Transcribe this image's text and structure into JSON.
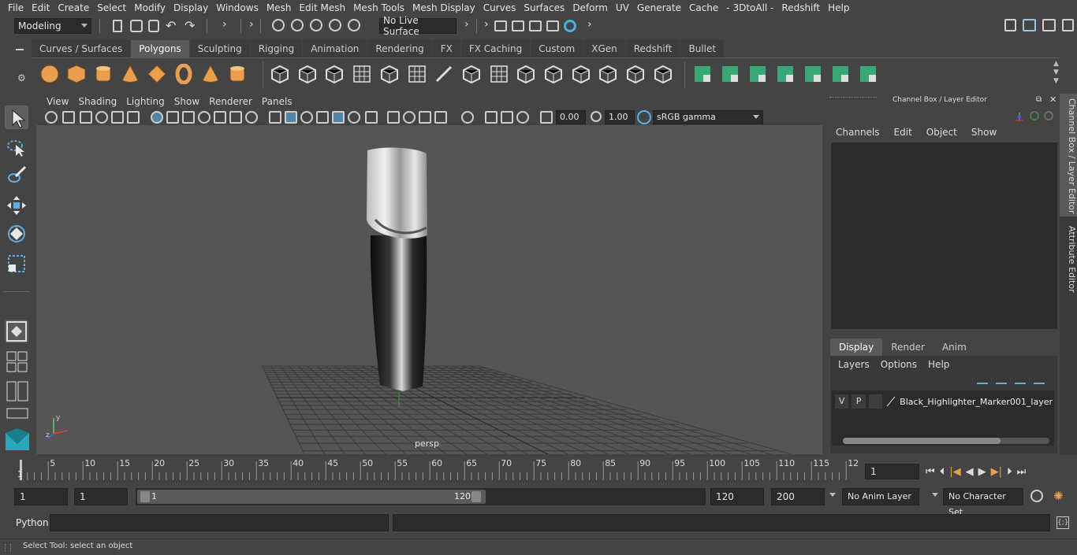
{
  "menubar": {
    "items": [
      "File",
      "Edit",
      "Create",
      "Select",
      "Modify",
      "Display",
      "Windows",
      "Mesh",
      "Edit Mesh",
      "Mesh Tools",
      "Mesh Display",
      "Curves",
      "Surfaces",
      "Deform",
      "UV",
      "Generate",
      "Cache",
      "- 3DtoAll -",
      "Redshift",
      "Help"
    ]
  },
  "statusline": {
    "mode": "Modeling",
    "live_surface": "No Live Surface"
  },
  "shelf": {
    "tabs": [
      "Curves / Surfaces",
      "Polygons",
      "Sculpting",
      "Rigging",
      "Animation",
      "Rendering",
      "FX",
      "FX Caching",
      "Custom",
      "XGen",
      "Redshift",
      "Bullet"
    ],
    "active_tab": "Polygons"
  },
  "viewport": {
    "menus": [
      "View",
      "Shading",
      "Lighting",
      "Show",
      "Renderer",
      "Panels"
    ],
    "exposure": "0.00",
    "gamma": "1.00",
    "color_space": "sRGB gamma",
    "camera_label": "persp"
  },
  "channel_box": {
    "title": "Channel Box / Layer Editor",
    "menus": [
      "Channels",
      "Edit",
      "Object",
      "Show"
    ],
    "layer_tabs": [
      "Display",
      "Render",
      "Anim"
    ],
    "active_layer_tab": "Display",
    "layer_menus": [
      "Layers",
      "Options",
      "Help"
    ],
    "layer": {
      "visible": "V",
      "playback": "P",
      "name": "Black_Highlighter_Marker001_layer"
    },
    "side_tabs": [
      "Channel Box / Layer Editor",
      "Attribute Editor"
    ]
  },
  "timeline": {
    "ticks": [
      "5",
      "10",
      "15",
      "20",
      "25",
      "30",
      "35",
      "40",
      "45",
      "50",
      "55",
      "60",
      "65",
      "70",
      "75",
      "80",
      "85",
      "90",
      "95",
      "100",
      "105",
      "110",
      "115",
      "12"
    ],
    "start_marker": "1",
    "current_frame": "1"
  },
  "range": {
    "start": "1",
    "anim_start": "1",
    "slider_start": "1",
    "slider_end": "120",
    "anim_end": "120",
    "end": "200",
    "anim_layer": "No Anim Layer",
    "character_set": "No Character Set"
  },
  "command_line": {
    "label": "Python"
  },
  "help_line": {
    "text": "Select Tool: select an object"
  },
  "colors": {
    "accent": "#5285a6",
    "shelf_orange": "#e8a050",
    "shelf_green": "#3aa876"
  }
}
